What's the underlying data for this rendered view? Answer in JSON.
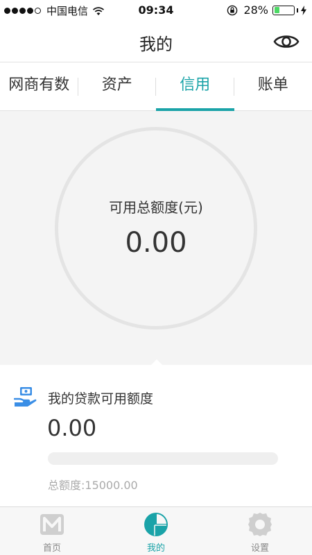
{
  "status_bar": {
    "carrier": "中国电信",
    "time": "09:34",
    "battery_percent": "28%",
    "battery_level": 0.28
  },
  "header": {
    "title": "我的",
    "action_icon": "eye-icon"
  },
  "tabs": [
    {
      "label": "网商有数",
      "active": false
    },
    {
      "label": "资产",
      "active": false
    },
    {
      "label": "信用",
      "active": true
    },
    {
      "label": "账单",
      "active": false
    }
  ],
  "credit": {
    "label": "可用总额度(元)",
    "value": "0.00"
  },
  "loan": {
    "icon": "hand-money-icon",
    "title": "我的贷款可用额度",
    "value": "0.00",
    "progress": 0,
    "total": "总额度:15000.00"
  },
  "tabbar": [
    {
      "label": "首页",
      "icon": "home-m-icon",
      "active": false
    },
    {
      "label": "我的",
      "icon": "pie-chart-icon",
      "active": true
    },
    {
      "label": "设置",
      "icon": "gear-icon",
      "active": false
    }
  ],
  "colors": {
    "accent": "#1aa3a8",
    "icon_blue": "#3a8ee6",
    "battery_green": "#4cd964",
    "inactive_icon": "#cfcfcf"
  }
}
